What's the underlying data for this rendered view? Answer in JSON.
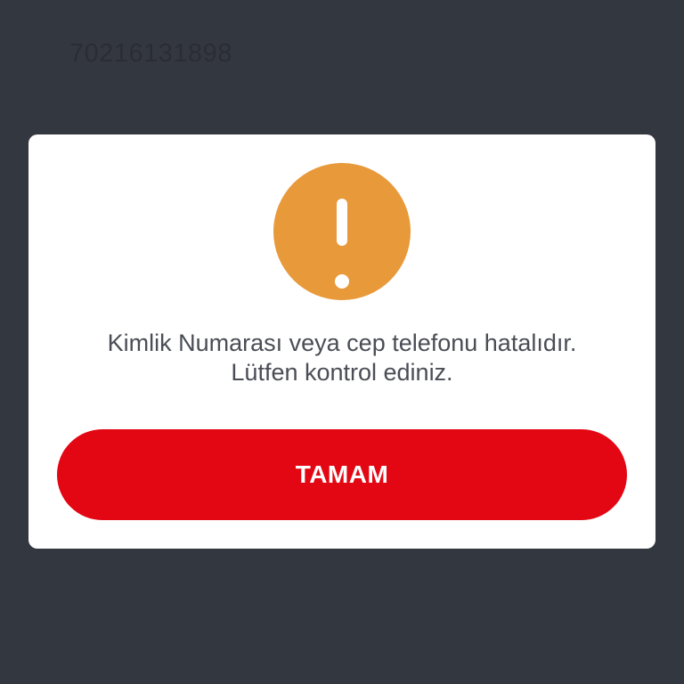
{
  "background": {
    "id_field_value": "70216131898"
  },
  "dialog": {
    "icon": "exclamation-icon",
    "icon_color": "#e8993a",
    "message_line1": "Kimlik Numarası veya cep telefonu hatalıdır.",
    "message_line2": "Lütfen kontrol ediniz.",
    "ok_label": "TAMAM",
    "button_color": "#e30613"
  }
}
